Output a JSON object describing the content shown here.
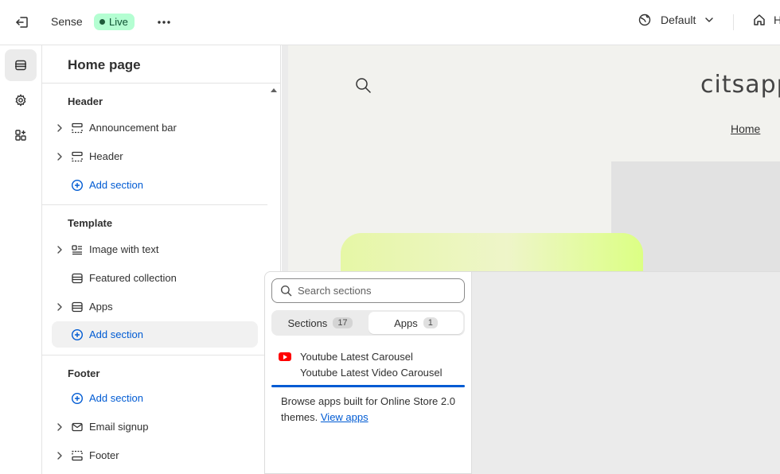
{
  "topbar": {
    "exit_icon": "exit-icon",
    "theme_name": "Sense",
    "live_badge": "Live",
    "more_icon": "more-horizontal-icon",
    "default_label": "Default",
    "home_label": "H"
  },
  "rail": {
    "items": [
      {
        "icon": "sections-icon",
        "active": true
      },
      {
        "icon": "gear-icon",
        "active": false
      },
      {
        "icon": "apps-icon",
        "active": false
      }
    ]
  },
  "sidebar": {
    "title": "Home page",
    "groups": {
      "header": {
        "heading": "Header",
        "items": [
          {
            "label": "Announcement bar",
            "icon": "announcement-bar-icon",
            "expandable": true
          },
          {
            "label": "Header",
            "icon": "header-layout-icon",
            "expandable": true
          }
        ],
        "add_label": "Add section"
      },
      "template": {
        "heading": "Template",
        "items": [
          {
            "label": "Image with text",
            "icon": "image-with-text-icon",
            "expandable": true
          },
          {
            "label": "Featured collection",
            "icon": "collection-icon",
            "expandable": false
          },
          {
            "label": "Apps",
            "icon": "apps-section-icon",
            "expandable": true
          }
        ],
        "add_label": "Add section"
      },
      "footer": {
        "heading": "Footer",
        "add_label": "Add section",
        "items": [
          {
            "label": "Email signup",
            "icon": "email-icon",
            "expandable": true
          },
          {
            "label": "Footer",
            "icon": "footer-layout-icon",
            "expandable": true
          }
        ]
      }
    }
  },
  "preview": {
    "store_name": "citsapp",
    "nav_home": "Home"
  },
  "popover": {
    "search_placeholder": "Search sections",
    "tabs": [
      {
        "label": "Sections",
        "count": "17",
        "selected": false
      },
      {
        "label": "Apps",
        "count": "1",
        "selected": true
      }
    ],
    "app": {
      "title": "Youtube Latest Carousel",
      "subtitle": "Youtube Latest Video Carousel",
      "icon": "youtube-icon"
    },
    "browse_text": "Browse apps built for Online Store 2.0 themes.",
    "browse_link": "View apps"
  },
  "colors": {
    "accent": "#005bd3",
    "live_badge_bg": "#b4fed2",
    "youtube_red": "#ff0000"
  }
}
